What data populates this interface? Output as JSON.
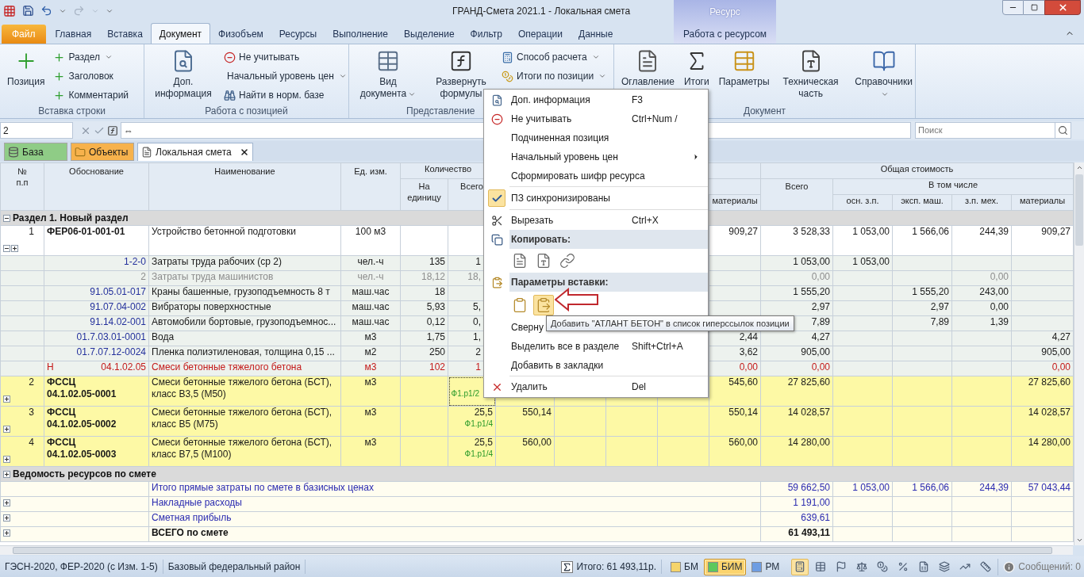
{
  "title_bar": {
    "title": "ГРАНД-Смета 2021.1 - Локальная смета",
    "context_header": "Ресурс"
  },
  "ribbon_tabs": [
    {
      "label": "Файл",
      "kind": "file",
      "selected": false
    },
    {
      "label": "Главная",
      "kind": "tab",
      "selected": false
    },
    {
      "label": "Вставка",
      "kind": "tab",
      "selected": false
    },
    {
      "label": "Документ",
      "kind": "tab",
      "selected": true
    },
    {
      "label": "Физобъем",
      "kind": "tab",
      "selected": false
    },
    {
      "label": "Ресурсы",
      "kind": "tab",
      "selected": false
    },
    {
      "label": "Выполнение",
      "kind": "tab",
      "selected": false
    },
    {
      "label": "Выделение",
      "kind": "tab",
      "selected": false
    },
    {
      "label": "Фильтр",
      "kind": "tab",
      "selected": false
    },
    {
      "label": "Операции",
      "kind": "tab",
      "selected": false
    },
    {
      "label": "Данные",
      "kind": "tab",
      "selected": false
    },
    {
      "label": "Работа с ресурсом",
      "kind": "context",
      "selected": false
    }
  ],
  "ribbon_groups": [
    {
      "label": "Вставка строки",
      "buttons": [
        {
          "label": "Позиция",
          "kind": "large",
          "dropdown": false
        },
        {
          "label": "Раздел",
          "kind": "small",
          "dropdown": true
        },
        {
          "label": "Заголовок",
          "kind": "small",
          "dropdown": false
        },
        {
          "label": "Комментарий",
          "kind": "small",
          "dropdown": false
        }
      ]
    },
    {
      "label": "Работа с позицией",
      "buttons": [
        {
          "label": "Доп. информация",
          "kind": "large",
          "dropdown": false
        },
        {
          "label": "Не учитывать",
          "kind": "small",
          "dropdown": false
        },
        {
          "label": "Начальный уровень цен",
          "kind": "small",
          "dropdown": true
        },
        {
          "label": "Найти в норм. базе",
          "kind": "small",
          "dropdown": false
        }
      ]
    },
    {
      "label": "Представление",
      "buttons": [
        {
          "label": "Вид документа",
          "kind": "large",
          "dropdown": true
        },
        {
          "label": "Развернуть формулы",
          "kind": "large",
          "dropdown": false
        },
        {
          "label": "Способ расчета",
          "kind": "small",
          "dropdown": true
        },
        {
          "label": "Итоги по позиции",
          "kind": "small",
          "dropdown": true
        }
      ]
    },
    {
      "label": "Документ",
      "buttons": [
        {
          "label": "Оглавление",
          "kind": "large",
          "dropdown": false
        },
        {
          "label": "Итоги",
          "kind": "large",
          "dropdown": false
        },
        {
          "label": "Параметры",
          "kind": "large",
          "dropdown": false
        },
        {
          "label": "Техническая часть",
          "kind": "large",
          "dropdown": false
        },
        {
          "label": "Справочники",
          "kind": "large",
          "dropdown": true
        }
      ]
    }
  ],
  "formula_bar": {
    "cell": "2",
    "value": "⇔"
  },
  "search": {
    "placeholder": "Поиск"
  },
  "doc_tabs": [
    {
      "label": "База",
      "color": "#8fcc86",
      "selected": false,
      "closable": false
    },
    {
      "label": "Объекты",
      "color": "#f7b24c",
      "selected": false,
      "closable": false
    },
    {
      "label": "Локальная смета",
      "color": "#ffffff",
      "selected": true,
      "closable": true
    }
  ],
  "table": {
    "header": {
      "no": "№ п.п",
      "basis": "Обоснование",
      "name": "Наименование",
      "unit": "Ед. изм.",
      "quantity": "Количество",
      "per_unit": "На единицу",
      "quantity_total": "Всего",
      "column_11": "материалы",
      "total_cost": "Общая стоимость",
      "cost_total": "Всего",
      "including": "В том числе",
      "base_wage": "осн. з.п.",
      "machine_cost": "эксп. маш.",
      "machine_wage": "з.п. мех.",
      "materials": "материалы"
    },
    "rows": [
      {
        "kind": "section",
        "label": "Раздел 1. Новый раздел",
        "expanded": true
      },
      {
        "kind": "position",
        "highlighted": false,
        "expanded": true,
        "focused": false,
        "basis_lines": [
          "ФЕР06-01-001-01"
        ],
        "cells": {
          "no": "1",
          "name": "Устройство бетонной подготовки",
          "unit": "100 м3",
          "column_11": "909,27",
          "cost_total": "3 528,33",
          "base_wage": "1 053,00",
          "machine_cost": "1 566,06",
          "machine_wage": "244,39",
          "materials": "909,27"
        }
      },
      {
        "kind": "resource",
        "greyed": false,
        "excluded": false,
        "cells": {
          "basis": "1-2-0",
          "name": "Затраты труда рабочих (ср 2)",
          "unit": "чел.-ч",
          "per_unit": "135",
          "qty": "1",
          "cost_total": "1 053,00",
          "base_wage": "1 053,00"
        }
      },
      {
        "kind": "resource",
        "greyed": true,
        "excluded": false,
        "cells": {
          "basis": "2",
          "name": "Затраты труда машинистов",
          "unit": "чел.-ч",
          "per_unit": "18,12",
          "qty": "18,",
          "cost_total": "0,00",
          "machine_wage": "0,00"
        }
      },
      {
        "kind": "resource",
        "greyed": false,
        "excluded": false,
        "cells": {
          "basis": "91.05.01-017",
          "name": "Краны башенные, грузоподъемность 8 т",
          "unit": "маш.час",
          "per_unit": "18",
          "cost_total": "1 555,20",
          "machine_cost": "1 555,20",
          "machine_wage": "243,00"
        }
      },
      {
        "kind": "resource",
        "greyed": false,
        "excluded": false,
        "cells": {
          "basis": "91.07.04-002",
          "name": "Вибраторы поверхностные",
          "unit": "маш.час",
          "per_unit": "5,93",
          "qty": "5,",
          "cost_total": "2,97",
          "machine_cost": "2,97",
          "machine_wage": "0,00"
        }
      },
      {
        "kind": "resource",
        "greyed": false,
        "excluded": false,
        "cells": {
          "basis": "91.14.02-001",
          "name": "Автомобили бортовые, грузоподъемнос...",
          "unit": "маш.час",
          "per_unit": "0,12",
          "qty": "0,",
          "cost_total": "7,89",
          "machine_cost": "7,89",
          "machine_wage": "1,39"
        }
      },
      {
        "kind": "resource",
        "greyed": false,
        "excluded": false,
        "cells": {
          "basis": "01.7.03.01-0001",
          "name": "Вода",
          "unit": "м3",
          "per_unit": "1,75",
          "qty": "1,",
          "column_11": "2,44",
          "cost_total": "4,27",
          "materials": "4,27"
        }
      },
      {
        "kind": "resource",
        "greyed": false,
        "excluded": false,
        "cells": {
          "basis": "01.7.07.12-0024",
          "name": "Пленка полиэтиленовая, толщина 0,15 ...",
          "unit": "м2",
          "per_unit": "250",
          "qty": "2",
          "column_11": "3,62",
          "cost_total": "905,00",
          "materials": "905,00"
        }
      },
      {
        "kind": "resource",
        "greyed": false,
        "excluded": true,
        "flag": "Н",
        "cells": {
          "basis": "04.1.02.05",
          "name": "Смеси бетонные тяжелого бетона",
          "unit": "м3",
          "per_unit": "102",
          "qty": "1",
          "column_11": "0,00",
          "cost_total": "0,00",
          "materials": "0,00"
        }
      },
      {
        "kind": "position",
        "highlighted": true,
        "expanded": false,
        "focused": true,
        "basis_lines": [
          "ФССЦ",
          "04.1.02.05-0001"
        ],
        "note": "Ф1.р1/2",
        "cells": {
          "no": "2",
          "name": "Смеси бетонные тяжелого бетона (БСТ), класс В3,5 (М50)",
          "unit": "м3",
          "column_11": "545,60",
          "cost_total": "27 825,60",
          "materials": "27 825,60"
        }
      },
      {
        "kind": "position",
        "highlighted": true,
        "expanded": false,
        "focused": false,
        "basis_lines": [
          "ФССЦ",
          "04.1.02.05-0002"
        ],
        "note": "Ф1.р1/4",
        "cells": {
          "no": "3",
          "name": "Смеси бетонные тяжелого бетона (БСТ), класс В5 (М75)",
          "unit": "м3",
          "qty": "25,5",
          "column_7": "550,14",
          "column_11": "550,14",
          "cost_total": "14 028,57",
          "materials": "14 028,57"
        }
      },
      {
        "kind": "position",
        "highlighted": true,
        "expanded": false,
        "focused": false,
        "basis_lines": [
          "ФССЦ",
          "04.1.02.05-0003"
        ],
        "note": "Ф1.р1/4",
        "cells": {
          "no": "4",
          "name": "Смеси бетонные тяжелого бетона (БСТ), класс В7,5 (М100)",
          "unit": "м3",
          "qty": "25,5",
          "column_7": "560,00",
          "column_11": "560,00",
          "cost_total": "14 280,00",
          "materials": "14 280,00"
        }
      },
      {
        "kind": "section",
        "label": "Ведомость ресурсов по смете",
        "expanded": false
      },
      {
        "kind": "total",
        "label": "Итого прямые затраты по смете в базисных ценах",
        "expandable": false,
        "cells": {
          "cost_total": "59 662,50",
          "base_wage": "1 053,00",
          "machine_cost": "1 566,06",
          "machine_wage": "244,39",
          "materials": "57 043,44"
        }
      },
      {
        "kind": "total",
        "label": "Накладные расходы",
        "expandable": true,
        "cells": {
          "cost_total": "1 191,00"
        }
      },
      {
        "kind": "total",
        "label": "Сметная прибыль",
        "expandable": true,
        "cells": {
          "cost_total": "639,61"
        }
      },
      {
        "kind": "grand_total",
        "label": "ВСЕГО по смете",
        "expandable": true,
        "cells": {
          "cost_total": "61 493,11"
        }
      }
    ]
  },
  "context_menu": {
    "items": [
      {
        "kind": "item",
        "label": "Доп. информация",
        "shortcut": "F3"
      },
      {
        "kind": "item",
        "label": "Не учитывать",
        "shortcut": "Ctrl+Num /"
      },
      {
        "kind": "item",
        "label": "Подчиненная позиция"
      },
      {
        "kind": "item",
        "label": "Начальный уровень цен",
        "submenu": true
      },
      {
        "kind": "item",
        "label": "Сформировать шифр ресурса"
      },
      {
        "kind": "separator"
      },
      {
        "kind": "check",
        "label": "ПЗ синхронизированы",
        "checked": true
      },
      {
        "kind": "separator"
      },
      {
        "kind": "item",
        "label": "Вырезать",
        "shortcut": "Ctrl+X"
      },
      {
        "kind": "header",
        "label": "Копировать:"
      },
      {
        "kind": "icons",
        "buttons": [
          {
            "selected": false
          },
          {
            "selected": false
          },
          {
            "selected": false
          }
        ]
      },
      {
        "kind": "header",
        "label": "Параметры вставки:"
      },
      {
        "kind": "icons",
        "buttons": [
          {
            "selected": false
          },
          {
            "selected": true
          }
        ]
      },
      {
        "kind": "item",
        "label": "Сверну"
      },
      {
        "kind": "item",
        "label": "Выделить все в разделе",
        "shortcut": "Shift+Ctrl+A"
      },
      {
        "kind": "item",
        "label": "Добавить в закладки"
      },
      {
        "kind": "separator"
      },
      {
        "kind": "item",
        "label": "Удалить",
        "shortcut": "Del"
      }
    ]
  },
  "tooltip": {
    "text": "Добавить \"АТЛАНТ БЕТОН\" в список гиперссылок позиции"
  },
  "status_bar": {
    "norms": "ГЭСН-2020, ФЕР-2020 (с Изм. 1-5)",
    "region": "Базовый федеральный район",
    "total": "Итого: 61 493,11р.",
    "modes": [
      {
        "label": "БМ",
        "color": "#f5d46b",
        "selected": false
      },
      {
        "label": "БИМ",
        "color": "#5cc85c",
        "selected": true
      },
      {
        "label": "РМ",
        "color": "#6e9de2",
        "selected": false
      }
    ],
    "tools": [
      {
        "selected": true
      },
      {
        "selected": false
      },
      {
        "selected": false
      },
      {
        "selected": false
      },
      {
        "selected": false
      },
      {
        "selected": false
      },
      {
        "selected": false
      },
      {
        "selected": false
      },
      {
        "selected": false
      },
      {
        "selected": false
      }
    ],
    "messages": "Сообщений: 0"
  }
}
